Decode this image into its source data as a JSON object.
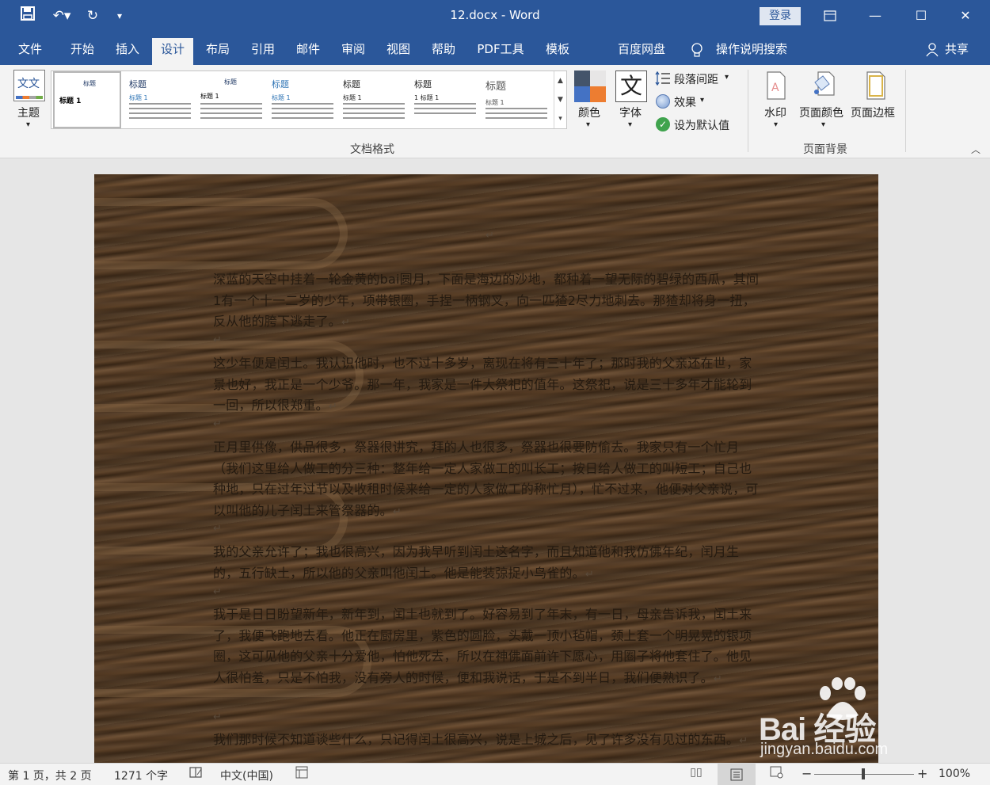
{
  "title_bar": {
    "title": "12.docx  -  Word",
    "login": "登录"
  },
  "tabs": [
    "文件",
    "开始",
    "插入",
    "设计",
    "布局",
    "引用",
    "邮件",
    "审阅",
    "视图",
    "帮助",
    "PDF工具",
    "模板",
    "百度网盘",
    "操作说明搜索"
  ],
  "active_tab": "设计",
  "share_label": "共享",
  "ribbon": {
    "theme_label": "主题",
    "theme_icon_text": "文文",
    "styles": [
      {
        "title": "标题",
        "sub": "标题 1"
      },
      {
        "title": "标题",
        "sub": "标题 1"
      },
      {
        "title": "标题",
        "sub": "标题 1"
      },
      {
        "title": "标题",
        "sub": "标题 1"
      },
      {
        "title": "标题",
        "sub": "标题 1"
      },
      {
        "title": "标题",
        "sub": "1  标题 1"
      },
      {
        "title": "标题",
        "sub": "标题 1"
      }
    ],
    "colors_label": "颜色",
    "fonts_label": "字体",
    "fonts_icon_text": "文",
    "para_spacing": "段落间距",
    "effects": "效果",
    "set_default": "设为默认值",
    "group_doc_format": "文档格式",
    "watermark": "水印",
    "page_color": "页面颜色",
    "page_border": "页面边框",
    "group_page_bg": "页面背景"
  },
  "document": {
    "paragraphs": [
      "深蓝的天空中挂着一轮金黄的bai圆月，下面是海边的沙地，都种着一望无际的碧绿的西瓜，其间1有一个十一二岁的少年，项带银圈，手捏一柄钢叉，向一匹猹2尽力地刺去。那猹却将身一扭，反从他的胯下逃走了。",
      "这少年便是闰土。我认识他时，也不过十多岁，离现在将有三十年了；那时我的父亲还在世，家景也好，我正是一个少爷。那一年，我家是一件大祭祀的值年。这祭祀，说是三十多年才能轮到一回，所以很郑重。",
      "正月里供像，供品很多，祭器很讲究，拜的人也很多，祭器也很要防偷去。我家只有一个忙月（我们这里给人做工的分三种：整年给一定人家做工的叫长工；按日给人做工的叫短工；自己也种地，只在过年过节以及收租时候来给一定的人家做工的称忙月），忙不过来，他便对父亲说，可以叫他的儿子闰土来管祭器的。",
      "我的父亲允许了；我也很高兴，因为我早听到闰土这名字，而且知道他和我仿佛年纪，闰月生的，五行缺土，所以他的父亲叫他闰土。他是能装弶捉小鸟雀的。",
      "我于是日日盼望新年，新年到，闰土也就到了。好容易到了年末，有一日，母亲告诉我，闰土来了，我便飞跑地去看。他正在厨房里，紫色的圆脸，头戴一顶小毡帽，颈上套一个明晃晃的银项圈，这可见他的父亲十分爱他，怕他死去，所以在神佛面前许下愿心，用圈子将他套住了。他见人很怕羞，只是不怕我，没有旁人的时候，便和我说话，于是不到半日，我们便熟识了。",
      "我们那时候不知道谈些什么，只记得闰土很高兴，说是上城之后，见了许多没有见过的东西。"
    ],
    "para_mark": "↵"
  },
  "status": {
    "page": "第 1 页，共 2 页",
    "words": "1271 个字",
    "language": "中文(中国)",
    "zoom": "100%"
  },
  "watermark": {
    "brand": "Bai  经验",
    "url": "jingyan.baidu.com"
  }
}
